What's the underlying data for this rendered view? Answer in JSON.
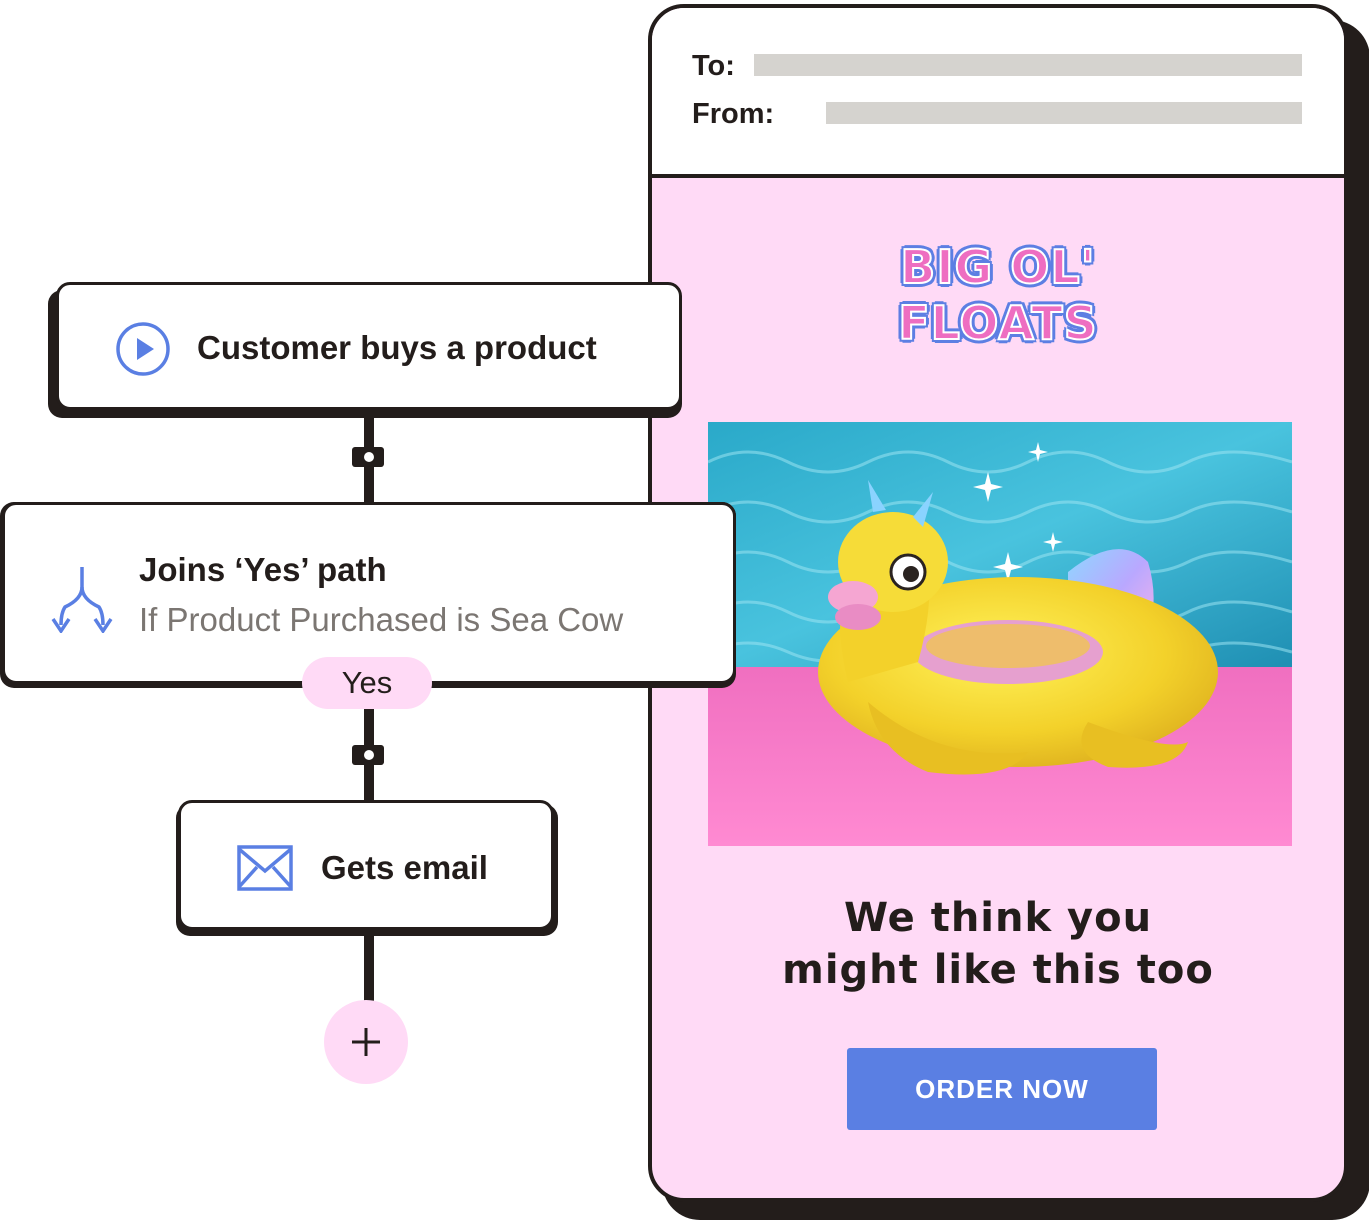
{
  "email": {
    "to_label": "To:",
    "from_label": "From:",
    "brand_logo_text": "BIG OL' FLOATS",
    "headline_line1": "We think you",
    "headline_line2": "might like this too",
    "cta_label": "ORDER NOW",
    "colors": {
      "background": "#ffdaf6",
      "cta": "#5a7fe3",
      "logo_pink": "#ee6ec1",
      "logo_blue": "#5d7fe3"
    }
  },
  "workflow": {
    "trigger": {
      "title": "Customer buys a product",
      "icon": "play-circle-icon"
    },
    "condition": {
      "title": "Joins ‘Yes’ path",
      "subtitle": "If Product Purchased is Sea Cow",
      "icon": "split-path-icon"
    },
    "branch_label": "Yes",
    "action": {
      "title": "Gets email",
      "icon": "envelope-icon"
    },
    "add_step_icon": "plus-icon",
    "accent_color": "#5a7fe3"
  }
}
